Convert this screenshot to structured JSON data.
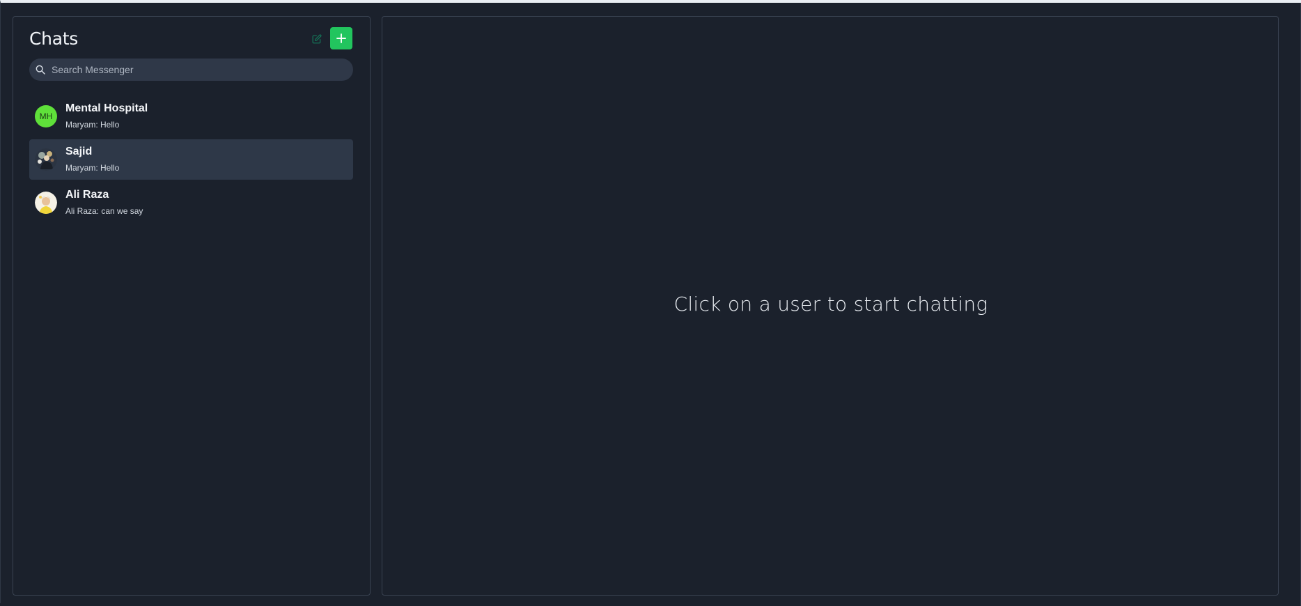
{
  "sidebar": {
    "title": "Chats",
    "compose_icon": "edit-icon",
    "add_icon": "plus-icon",
    "accent_color": "#22c55e",
    "search": {
      "icon": "search-icon",
      "placeholder": "Search Messenger",
      "value": ""
    },
    "chats": [
      {
        "name": "Mental Hospital",
        "preview": "Maryam: Hello",
        "avatar_initials": "MH",
        "avatar_color": "#5fe03a",
        "active": false
      },
      {
        "name": "Sajid",
        "preview": "Maryam: Hello",
        "avatar_initials": "",
        "active": true
      },
      {
        "name": "Ali Raza",
        "preview": "Ali Raza: can we say",
        "avatar_initials": "",
        "active": false
      }
    ]
  },
  "main": {
    "empty_message": "Click on a user to start chatting"
  }
}
